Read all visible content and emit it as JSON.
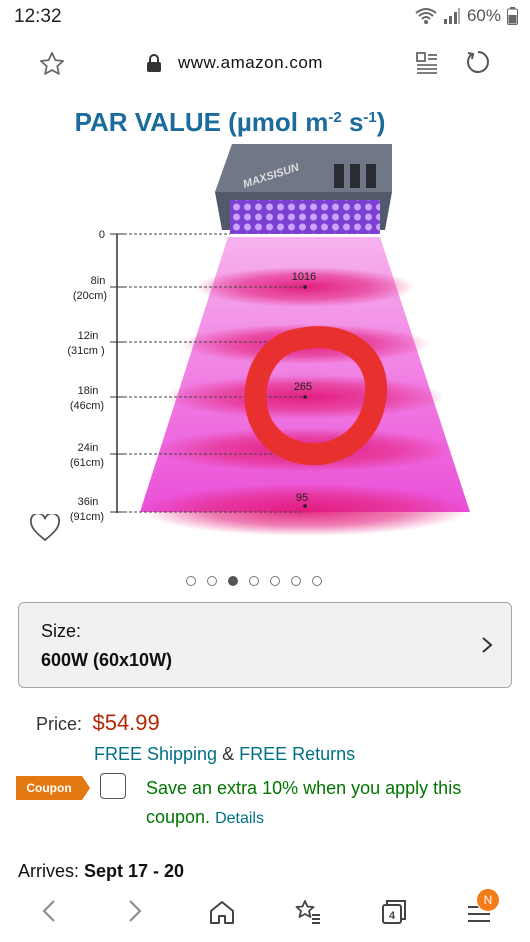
{
  "status": {
    "time": "12:32",
    "battery": "60%"
  },
  "browser": {
    "url": "www.amazon.com",
    "tab_count": "4",
    "menu_badge": "N"
  },
  "chart": {
    "title": "PAR VALUE (µmol m",
    "title_exp1": "-2",
    "title_mid": " s",
    "title_exp2": "-1",
    "title_end": ")",
    "brand": "MAXSISUN",
    "levels": [
      {
        "label1": "0",
        "label2": "",
        "value": ""
      },
      {
        "label1": "8in",
        "label2": "(20cm)",
        "value": "1016"
      },
      {
        "label1": "12in",
        "label2": "(31cm )",
        "value": ""
      },
      {
        "label1": "18in",
        "label2": "(46cm)",
        "value": "265"
      },
      {
        "label1": "24in",
        "label2": "(61cm)",
        "value": ""
      },
      {
        "label1": "36in",
        "label2": "(91cm)",
        "value": "95"
      }
    ]
  },
  "carousel": {
    "count": 7,
    "active_index": 2
  },
  "size": {
    "label": "Size:",
    "value": "600W (60x10W)"
  },
  "price": {
    "label": "Price:",
    "value": "$54.99"
  },
  "shipping": {
    "free_shipping": "FREE Shipping",
    "amp": " & ",
    "free_returns": "FREE Returns"
  },
  "coupon": {
    "badge": "Coupon",
    "text": "Save an extra 10% when you apply this coupon.",
    "details": "Details"
  },
  "arrives": {
    "label": "Arrives: ",
    "dates": "Sept 17 - 20"
  },
  "colors": {
    "price": "#b12704",
    "link": "#007185",
    "coupon_green": "#007600",
    "coupon_badge": "#e47911",
    "title_blue": "#1b6b9c"
  }
}
